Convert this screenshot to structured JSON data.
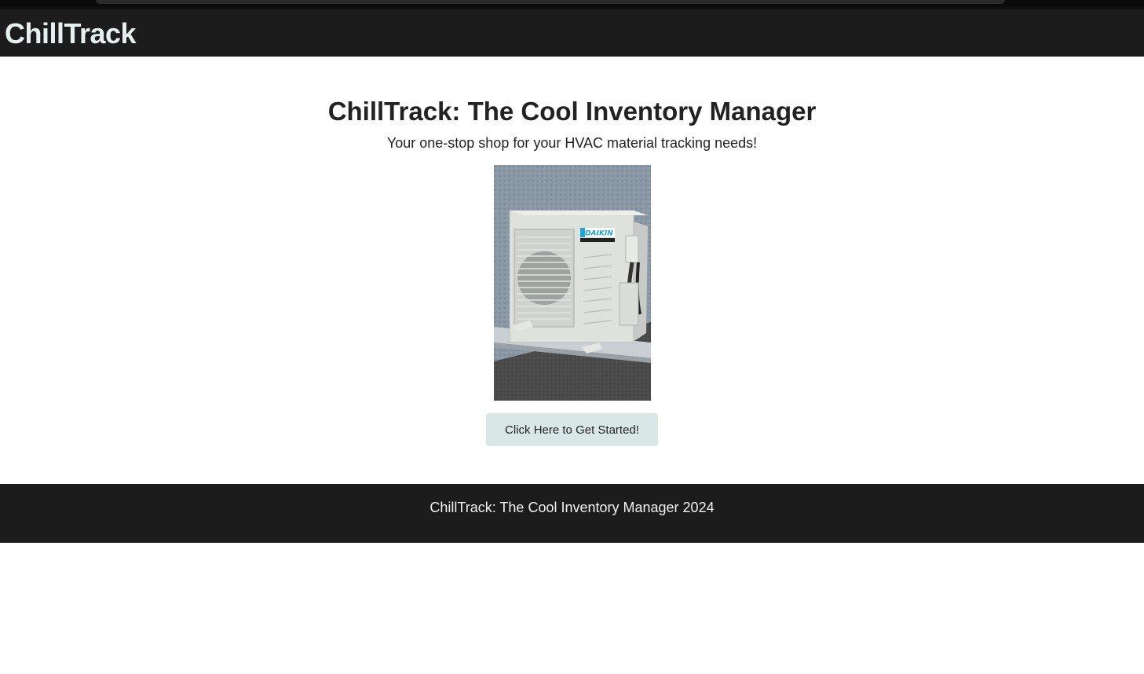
{
  "app": {
    "brand": "ChillTrack"
  },
  "hero": {
    "title": "ChillTrack: The Cool Inventory Manager",
    "subtitle": "Your one-stop shop for your HVAC material tracking needs!",
    "image": {
      "label": "DAIKIN",
      "icon": "hvac-outdoor-unit-photo"
    },
    "cta_label": "Click Here to Get Started!"
  },
  "footer": {
    "text": "ChillTrack: The Cool Inventory Manager 2024"
  },
  "colors": {
    "header_bg": "#1c1c1c",
    "brand_text": "#e6f0ef",
    "button_bg": "#d9e8e6",
    "footer_bg": "#1c1c1c"
  }
}
